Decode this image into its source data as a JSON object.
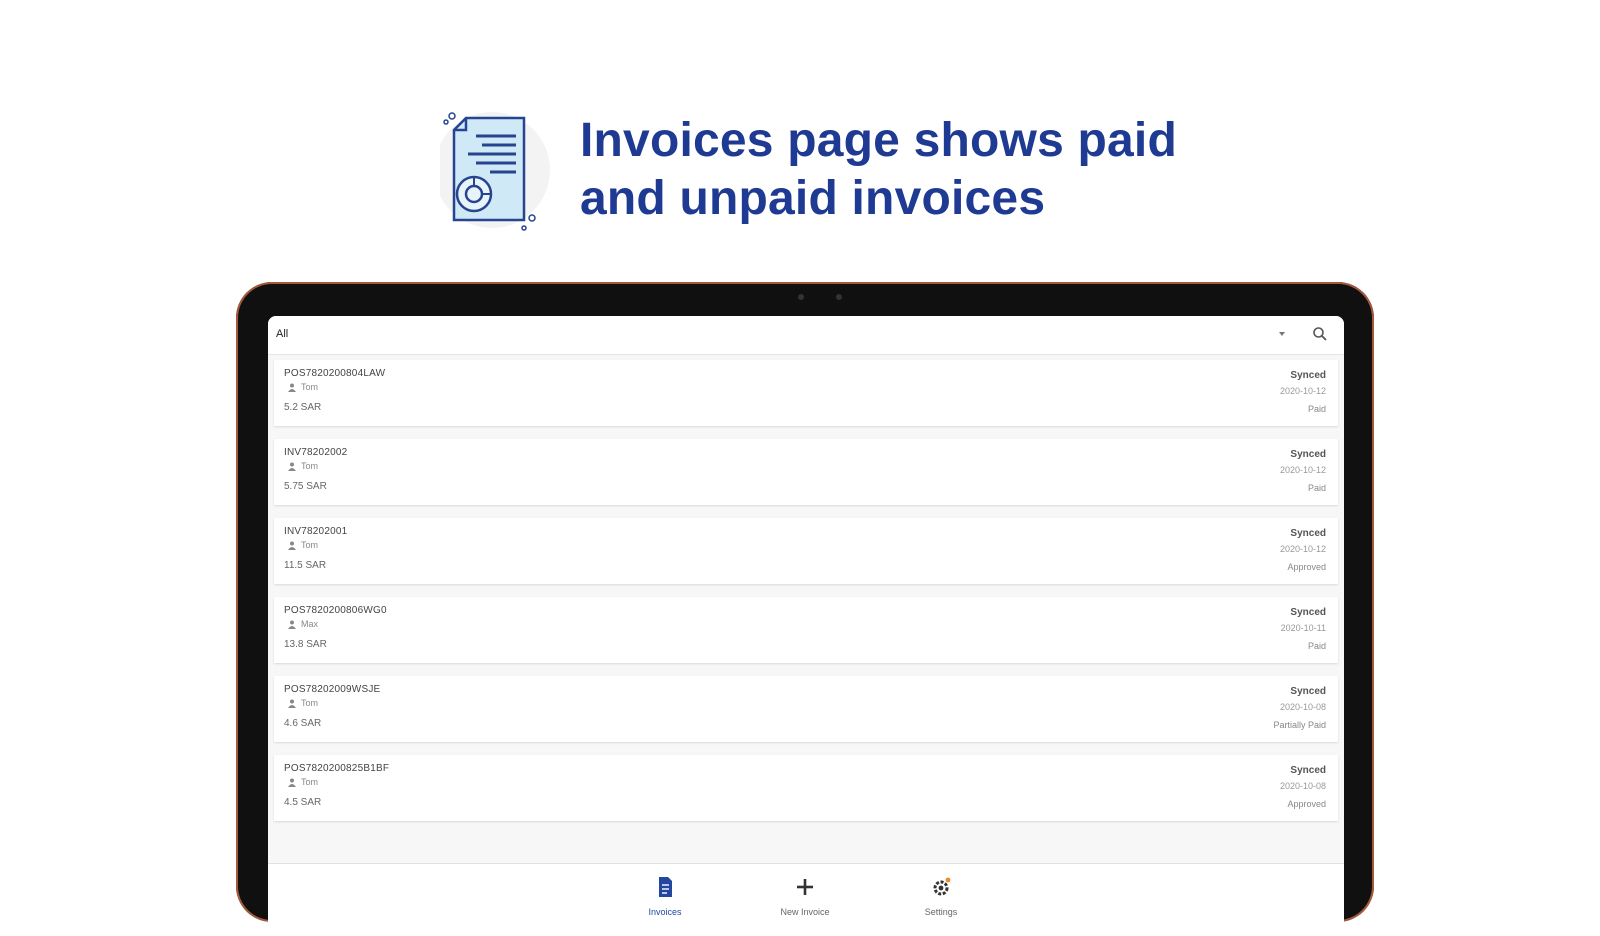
{
  "headline": {
    "line1": "Invoices page shows paid",
    "line2": "and unpaid invoices",
    "icon": "invoice-document-icon",
    "color": "#1f3a93"
  },
  "app": {
    "filter": {
      "selected": "All"
    },
    "invoices": [
      {
        "number": "POS7820200804LAW",
        "user": "Tom",
        "amount": "5.2 SAR",
        "sync": "Synced",
        "date": "2020-10-12",
        "status": "Paid"
      },
      {
        "number": "INV78202002",
        "user": "Tom",
        "amount": "5.75 SAR",
        "sync": "Synced",
        "date": "2020-10-12",
        "status": "Paid"
      },
      {
        "number": "INV78202001",
        "user": "Tom",
        "amount": "11.5 SAR",
        "sync": "Synced",
        "date": "2020-10-12",
        "status": "Approved"
      },
      {
        "number": "POS7820200806WG0",
        "user": "Max",
        "amount": "13.8 SAR",
        "sync": "Synced",
        "date": "2020-10-11",
        "status": "Paid"
      },
      {
        "number": "POS78202009WSJE",
        "user": "Tom",
        "amount": "4.6 SAR",
        "sync": "Synced",
        "date": "2020-10-08",
        "status": "Partially Paid"
      },
      {
        "number": "POS7820200825B1BF",
        "user": "Tom",
        "amount": "4.5 SAR",
        "sync": "Synced",
        "date": "2020-10-08",
        "status": "Approved"
      }
    ],
    "nav": {
      "invoices": "Invoices",
      "new_invoice": "New Invoice",
      "settings": "Settings"
    },
    "colors": {
      "accent": "#2346a0",
      "badge": "#f08a24"
    }
  }
}
